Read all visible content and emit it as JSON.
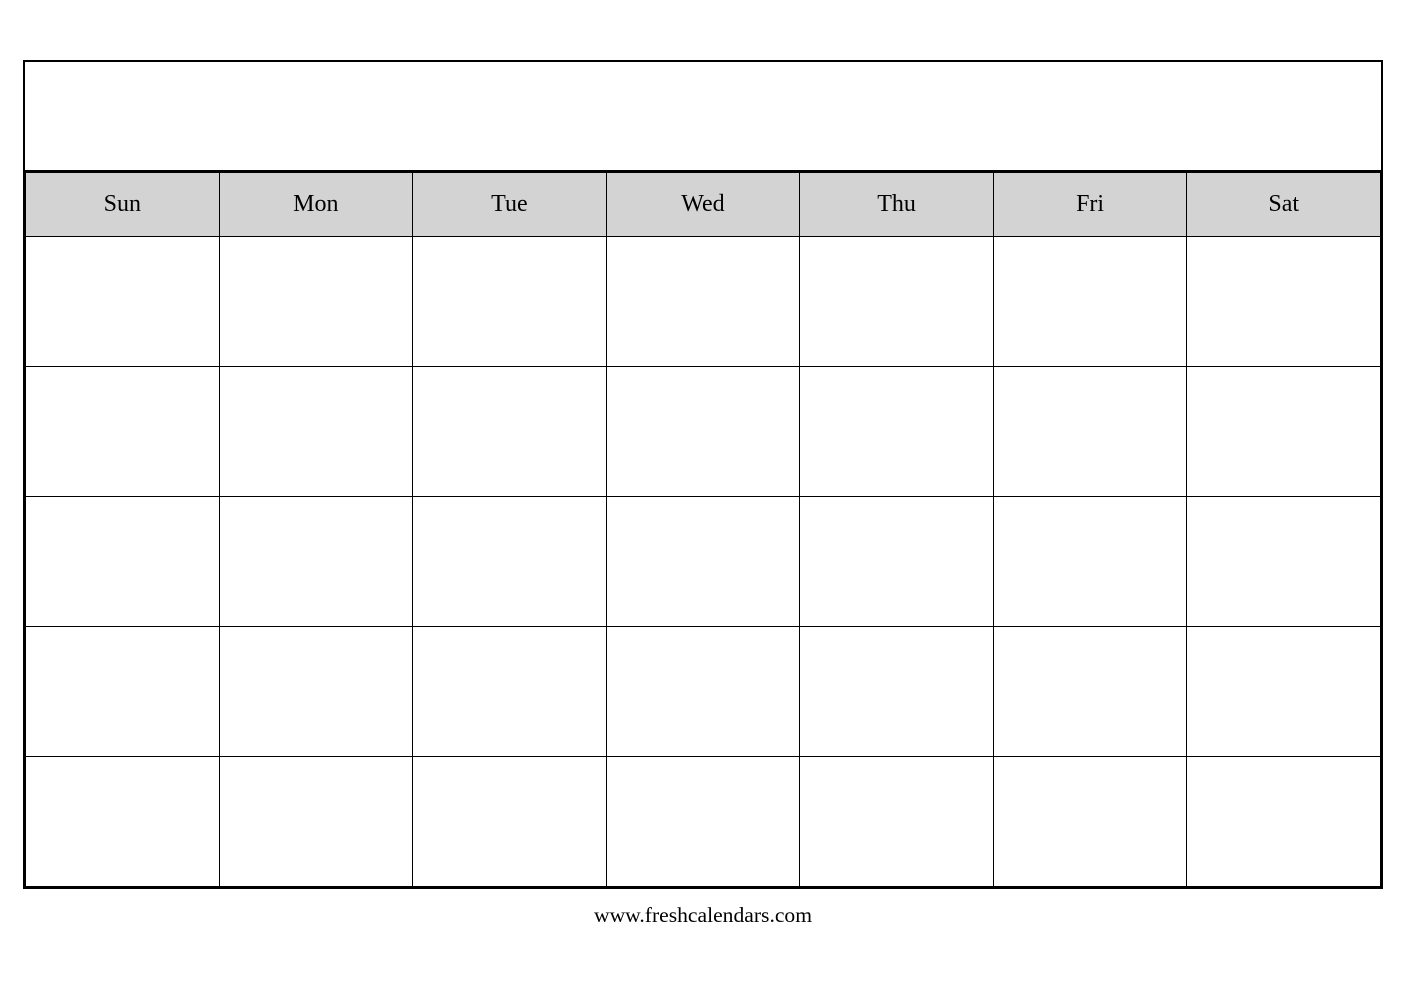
{
  "calendar": {
    "title": "",
    "days": [
      "Sun",
      "Mon",
      "Tue",
      "Wed",
      "Thu",
      "Fri",
      "Sat"
    ],
    "weeks": 5,
    "footer": "www.freshcalendars.com"
  }
}
